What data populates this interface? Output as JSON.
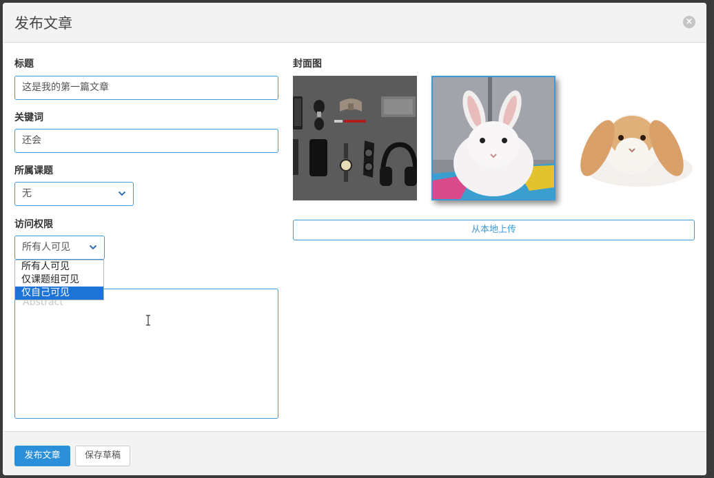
{
  "header": {
    "title": "发布文章",
    "close_icon": "close-icon"
  },
  "form": {
    "title_label": "标题",
    "title_value": "这是我的第一篇文章",
    "keywords_label": "关键词",
    "keywords_value": "还会",
    "topic_label": "所属课题",
    "topic_value": "无",
    "access_label": "访问权限",
    "access_value": "所有人可见",
    "access_options": [
      "所有人可见",
      "仅课题组可见",
      "仅自己可见"
    ],
    "access_highlighted_index": 2,
    "abstract_placeholder": "Abstract"
  },
  "cover": {
    "label": "封面图",
    "images": [
      {
        "name": "accessories-flatlay",
        "selected": false
      },
      {
        "name": "white-rabbit",
        "selected": true
      },
      {
        "name": "lop-ear-rabbit",
        "selected": false
      }
    ],
    "upload_label": "从本地上传"
  },
  "footer": {
    "publish_label": "发布文章",
    "draft_label": "保存草稿"
  },
  "colors": {
    "accent": "#3b99d8",
    "primary_button": "#2b8fd9",
    "dropdown_highlight": "#1e73d6"
  }
}
